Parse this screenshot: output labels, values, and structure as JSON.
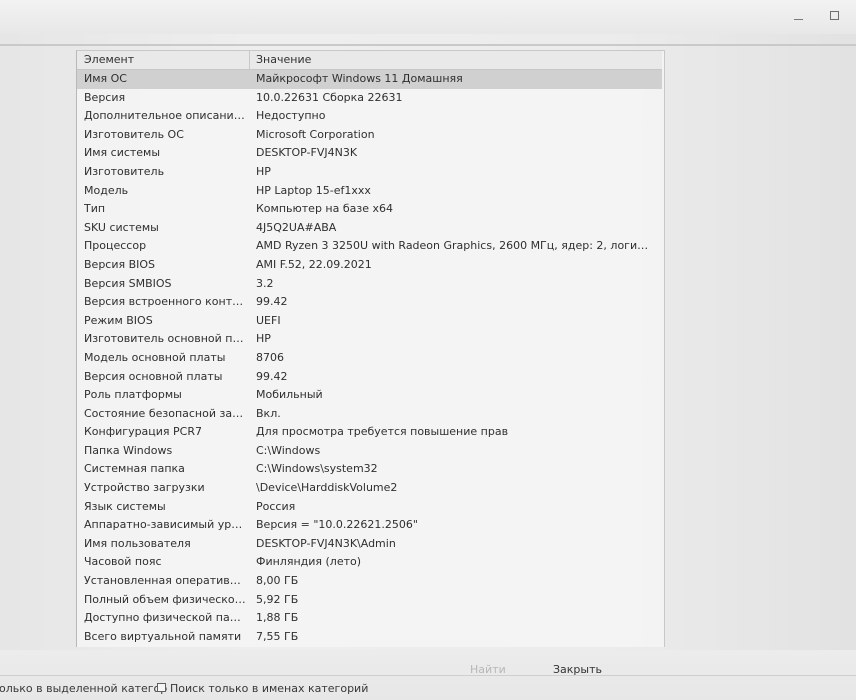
{
  "window": {
    "minimize_icon": "minimize-icon",
    "maximize_icon": "maximize-icon"
  },
  "table": {
    "headers": {
      "element": "Элемент",
      "value": "Значение"
    },
    "rows": [
      {
        "element": "Имя ОС",
        "value": "Майкрософт Windows 11 Домашняя",
        "selected": true
      },
      {
        "element": "Версия",
        "value": "10.0.22631 Сборка 22631"
      },
      {
        "element": "Дополнительное описание ...",
        "value": "Недоступно"
      },
      {
        "element": "Изготовитель ОС",
        "value": "Microsoft Corporation"
      },
      {
        "element": "Имя системы",
        "value": "DESKTOP-FVJ4N3K"
      },
      {
        "element": "Изготовитель",
        "value": "HP"
      },
      {
        "element": "Модель",
        "value": "HP Laptop 15-ef1xxx"
      },
      {
        "element": "Тип",
        "value": "Компьютер на базе x64"
      },
      {
        "element": "SKU системы",
        "value": "4J5Q2UA#ABA"
      },
      {
        "element": "Процессор",
        "value": "AMD Ryzen 3 3250U with Radeon Graphics, 2600 МГц, ядер: 2, логически..."
      },
      {
        "element": "Версия BIOS",
        "value": "AMI F.52, 22.09.2021"
      },
      {
        "element": "Версия SMBIOS",
        "value": "3.2"
      },
      {
        "element": "Версия встроенного контрол...",
        "value": "99.42"
      },
      {
        "element": "Режим BIOS",
        "value": "UEFI"
      },
      {
        "element": "Изготовитель основной платы",
        "value": "HP"
      },
      {
        "element": "Модель основной платы",
        "value": "8706"
      },
      {
        "element": "Версия основной платы",
        "value": "99.42"
      },
      {
        "element": "Роль платформы",
        "value": "Мобильный"
      },
      {
        "element": "Состояние безопасной загру...",
        "value": "Вкл."
      },
      {
        "element": "Конфигурация PCR7",
        "value": "Для просмотра требуется повышение прав"
      },
      {
        "element": "Папка Windows",
        "value": "C:\\Windows"
      },
      {
        "element": "Системная папка",
        "value": "C:\\Windows\\system32"
      },
      {
        "element": "Устройство загрузки",
        "value": "\\Device\\HarddiskVolume2"
      },
      {
        "element": "Язык системы",
        "value": "Россия"
      },
      {
        "element": "Аппаратно-зависимый уров...",
        "value": "Версия = \"10.0.22621.2506\""
      },
      {
        "element": "Имя пользователя",
        "value": "DESKTOP-FVJ4N3K\\Admin"
      },
      {
        "element": "Часовой пояс",
        "value": "Финляндия (лето)"
      },
      {
        "element": "Установленная оперативная...",
        "value": "8,00 ГБ"
      },
      {
        "element": "Полный объем физической ...",
        "value": "5,92 ГБ"
      },
      {
        "element": "Доступно физической памяти",
        "value": "1,88 ГБ"
      },
      {
        "element": "Всего виртуальной памяти",
        "value": "7,55 ГБ"
      }
    ]
  },
  "footer": {
    "find_label": "Найти",
    "close_label": "Закрыть",
    "search_selected_label": "олько в выделенной категор",
    "search_categories_label": "Поиск только в именах категорий"
  }
}
